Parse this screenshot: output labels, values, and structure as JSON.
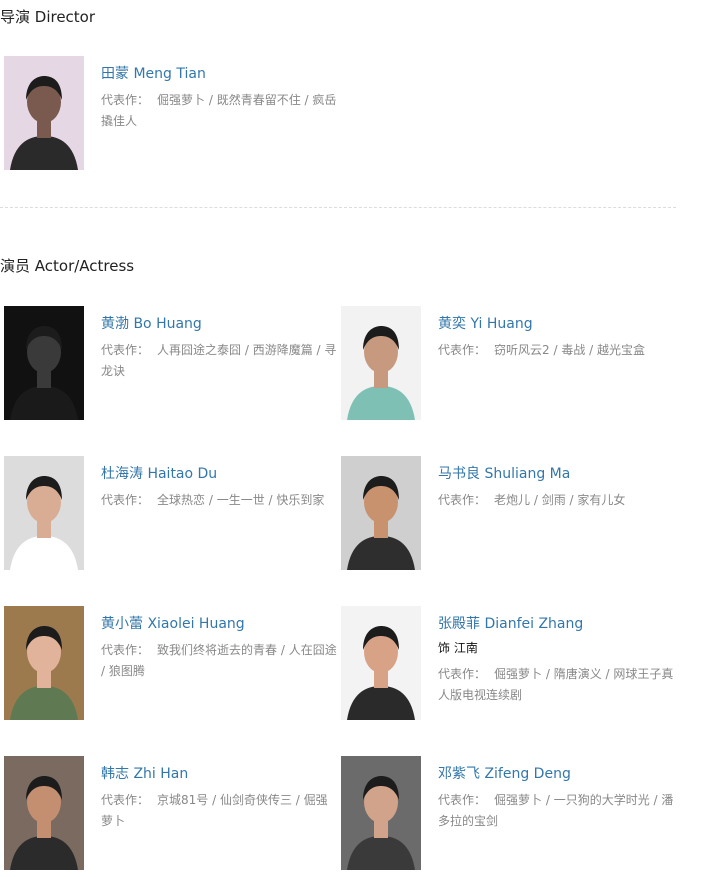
{
  "director_section": {
    "heading": "导演 Director",
    "people": [
      {
        "name": "田蒙 Meng Tian",
        "works": [
          "倔强萝卜",
          "既然青春留不住",
          "疯岳撬佳人"
        ]
      }
    ]
  },
  "cast_section": {
    "heading": "演员 Actor/Actress",
    "people": [
      {
        "name": "黄渤 Bo Huang",
        "works": [
          "人再囧途之泰囧",
          "西游降魔篇",
          "寻龙诀"
        ]
      },
      {
        "name": "黄奕 Yi Huang",
        "works": [
          "窃听风云2",
          "毒战",
          "越光宝盒"
        ]
      },
      {
        "name": "杜海涛 Haitao Du",
        "works": [
          "全球热恋",
          "一生一世",
          "快乐到家"
        ]
      },
      {
        "name": "马书良 Shuliang Ma",
        "works": [
          "老炮儿",
          "剑雨",
          "家有儿女"
        ]
      },
      {
        "name": "黄小蕾 Xiaolei Huang",
        "works": [
          "致我们终将逝去的青春",
          "人在囧途",
          "狼图腾"
        ]
      },
      {
        "name": "张殿菲 Dianfei Zhang",
        "role": "饰 江南",
        "works": [
          "倔强萝卜",
          "隋唐演义",
          "网球王子真人版电视连续剧"
        ]
      },
      {
        "name": "韩志 Zhi Han",
        "works": [
          "京城81号",
          "仙剑奇侠传三",
          "倔强萝卜"
        ]
      },
      {
        "name": "邓紫飞 Zifeng Deng",
        "works": [
          "倔强萝卜",
          "一只狗的大学时光",
          "潘多拉的宝剑"
        ]
      }
    ]
  },
  "works_label": "代表作："
}
